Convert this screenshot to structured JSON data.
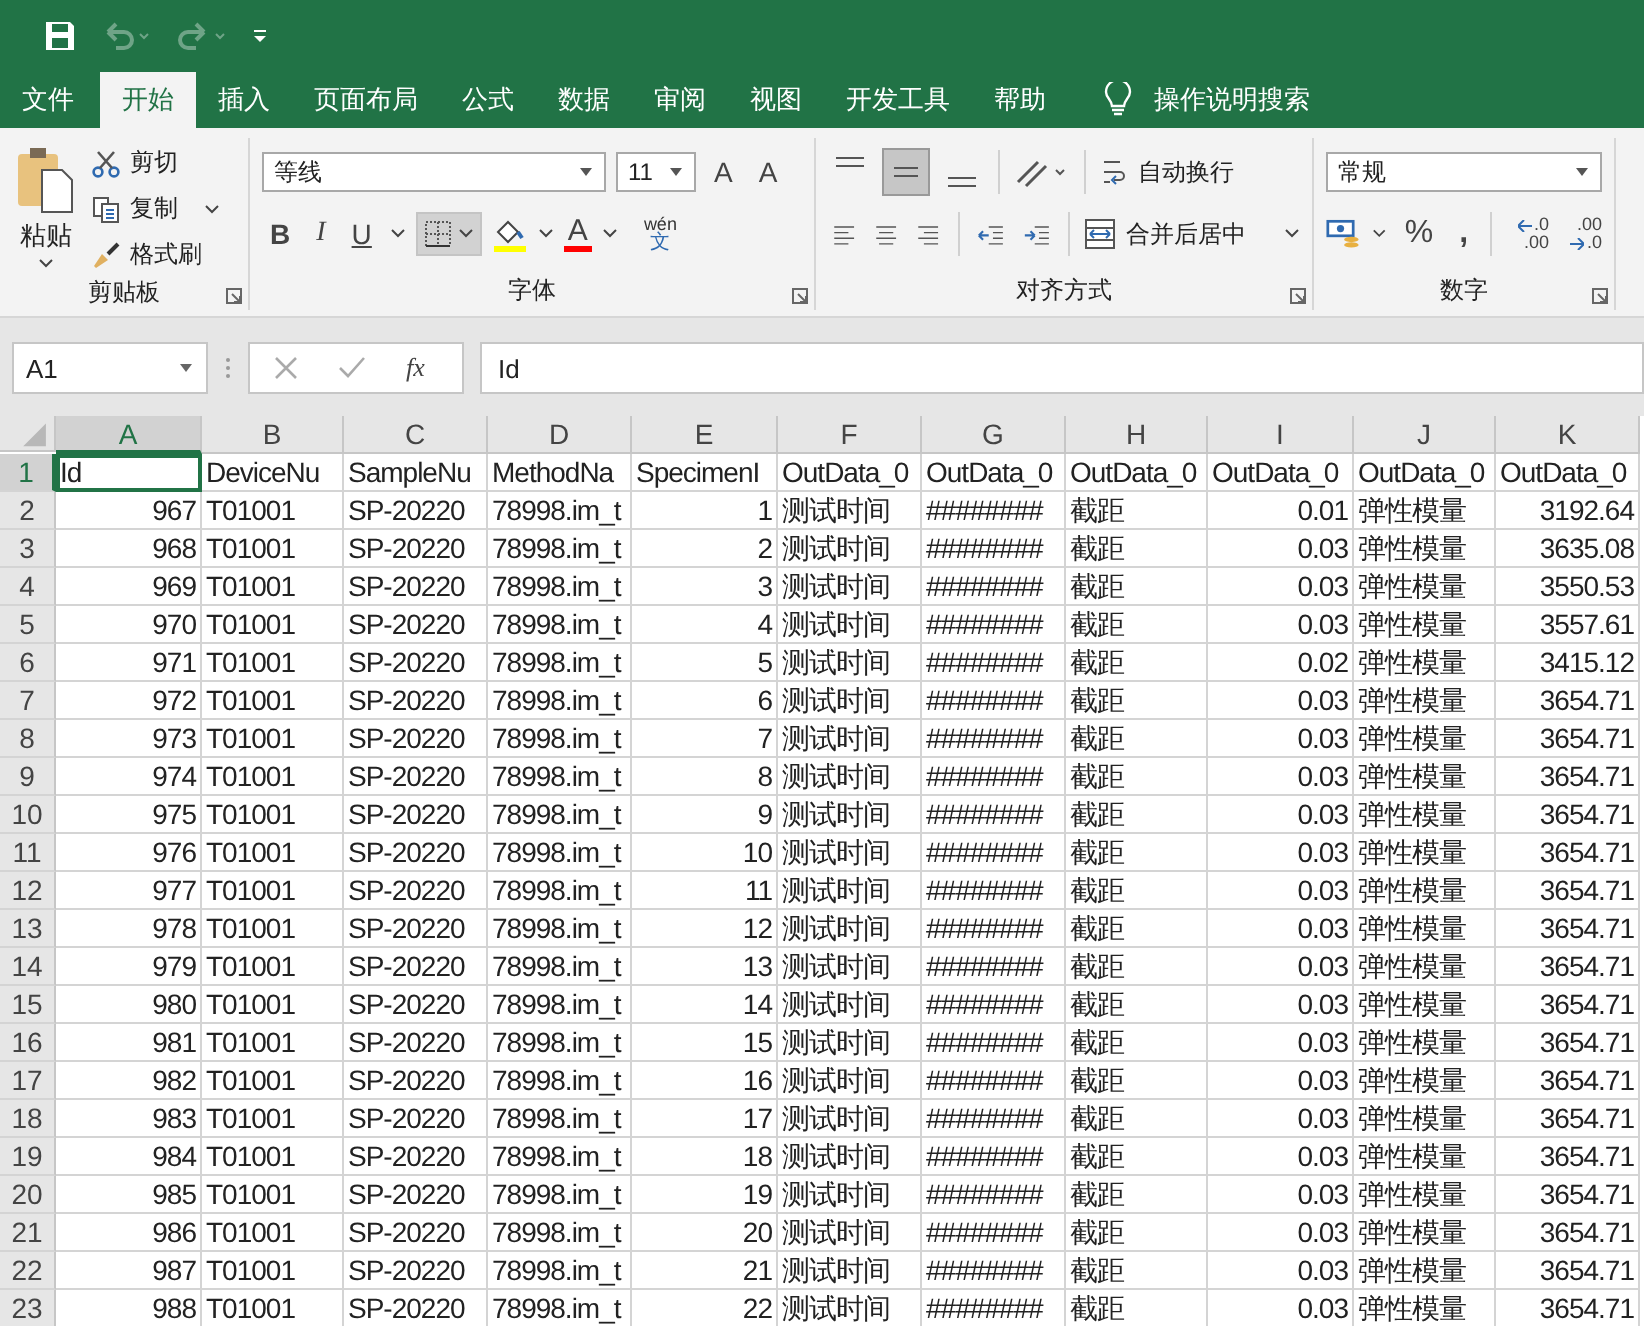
{
  "menu_tabs": [
    {
      "label": "文件",
      "selected": false
    },
    {
      "label": "开始",
      "selected": true
    },
    {
      "label": "插入",
      "selected": false
    },
    {
      "label": "页面布局",
      "selected": false
    },
    {
      "label": "公式",
      "selected": false
    },
    {
      "label": "数据",
      "selected": false
    },
    {
      "label": "审阅",
      "selected": false
    },
    {
      "label": "视图",
      "selected": false
    },
    {
      "label": "开发工具",
      "selected": false
    },
    {
      "label": "帮助",
      "selected": false
    }
  ],
  "tell_me": "操作说明搜索",
  "clipboard": {
    "paste": "粘贴",
    "cut": "剪切",
    "copy": "复制",
    "format_painter": "格式刷",
    "label": "剪贴板"
  },
  "font": {
    "name": "等线",
    "size": "11",
    "grow": "A",
    "shrink": "A",
    "bold": "B",
    "italic": "I",
    "underline": "U",
    "font_color": "A",
    "phonetic_top": "wén",
    "phonetic_bottom": "文",
    "label": "字体"
  },
  "alignment": {
    "wrap_text": "自动换行",
    "merge_center": "合并后居中",
    "label": "对齐方式",
    "middle_align_selected": true
  },
  "number": {
    "format": "常规",
    "percent": "%",
    "comma": ",",
    "increase_decimal": [
      ".0",
      ".00"
    ],
    "decrease_decimal": [
      ".00",
      ".0"
    ],
    "label": "数字"
  },
  "formula_bar": {
    "name_box": "A1",
    "fx": "fx",
    "value": "Id"
  },
  "columns": [
    {
      "letter": "A",
      "selected": true,
      "numeric": true
    },
    {
      "letter": "B",
      "selected": false,
      "numeric": false
    },
    {
      "letter": "C",
      "selected": false,
      "numeric": false
    },
    {
      "letter": "D",
      "selected": false,
      "numeric": false
    },
    {
      "letter": "E",
      "selected": false,
      "numeric": true
    },
    {
      "letter": "F",
      "selected": false,
      "numeric": false
    },
    {
      "letter": "G",
      "selected": false,
      "numeric": false
    },
    {
      "letter": "H",
      "selected": false,
      "numeric": false
    },
    {
      "letter": "I",
      "selected": false,
      "numeric": true
    },
    {
      "letter": "J",
      "selected": false,
      "numeric": false
    },
    {
      "letter": "K",
      "selected": false,
      "numeric": true
    }
  ],
  "header_row": {
    "number": "1",
    "selected": true,
    "cells": [
      "Id",
      "DeviceNu",
      "SampleNu",
      "MethodNa",
      "SpecimenI",
      "OutData_0",
      "OutData_0",
      "OutData_0",
      "OutData_0",
      "OutData_0",
      "OutData_0"
    ]
  },
  "rows": [
    {
      "number": "2",
      "cells": [
        "967",
        "T01001",
        "SP-20220",
        "78998.im_t",
        "1",
        "测试时间",
        "########",
        "截距",
        "0.01",
        "弹性模量",
        "3192.64"
      ]
    },
    {
      "number": "3",
      "cells": [
        "968",
        "T01001",
        "SP-20220",
        "78998.im_t",
        "2",
        "测试时间",
        "########",
        "截距",
        "0.03",
        "弹性模量",
        "3635.08"
      ]
    },
    {
      "number": "4",
      "cells": [
        "969",
        "T01001",
        "SP-20220",
        "78998.im_t",
        "3",
        "测试时间",
        "########",
        "截距",
        "0.03",
        "弹性模量",
        "3550.53"
      ]
    },
    {
      "number": "5",
      "cells": [
        "970",
        "T01001",
        "SP-20220",
        "78998.im_t",
        "4",
        "测试时间",
        "########",
        "截距",
        "0.03",
        "弹性模量",
        "3557.61"
      ]
    },
    {
      "number": "6",
      "cells": [
        "971",
        "T01001",
        "SP-20220",
        "78998.im_t",
        "5",
        "测试时间",
        "########",
        "截距",
        "0.02",
        "弹性模量",
        "3415.12"
      ]
    },
    {
      "number": "7",
      "cells": [
        "972",
        "T01001",
        "SP-20220",
        "78998.im_t",
        "6",
        "测试时间",
        "########",
        "截距",
        "0.03",
        "弹性模量",
        "3654.71"
      ]
    },
    {
      "number": "8",
      "cells": [
        "973",
        "T01001",
        "SP-20220",
        "78998.im_t",
        "7",
        "测试时间",
        "########",
        "截距",
        "0.03",
        "弹性模量",
        "3654.71"
      ]
    },
    {
      "number": "9",
      "cells": [
        "974",
        "T01001",
        "SP-20220",
        "78998.im_t",
        "8",
        "测试时间",
        "########",
        "截距",
        "0.03",
        "弹性模量",
        "3654.71"
      ]
    },
    {
      "number": "10",
      "cells": [
        "975",
        "T01001",
        "SP-20220",
        "78998.im_t",
        "9",
        "测试时间",
        "########",
        "截距",
        "0.03",
        "弹性模量",
        "3654.71"
      ]
    },
    {
      "number": "11",
      "cells": [
        "976",
        "T01001",
        "SP-20220",
        "78998.im_t",
        "10",
        "测试时间",
        "########",
        "截距",
        "0.03",
        "弹性模量",
        "3654.71"
      ]
    },
    {
      "number": "12",
      "cells": [
        "977",
        "T01001",
        "SP-20220",
        "78998.im_t",
        "11",
        "测试时间",
        "########",
        "截距",
        "0.03",
        "弹性模量",
        "3654.71"
      ]
    },
    {
      "number": "13",
      "cells": [
        "978",
        "T01001",
        "SP-20220",
        "78998.im_t",
        "12",
        "测试时间",
        "########",
        "截距",
        "0.03",
        "弹性模量",
        "3654.71"
      ]
    },
    {
      "number": "14",
      "cells": [
        "979",
        "T01001",
        "SP-20220",
        "78998.im_t",
        "13",
        "测试时间",
        "########",
        "截距",
        "0.03",
        "弹性模量",
        "3654.71"
      ]
    },
    {
      "number": "15",
      "cells": [
        "980",
        "T01001",
        "SP-20220",
        "78998.im_t",
        "14",
        "测试时间",
        "########",
        "截距",
        "0.03",
        "弹性模量",
        "3654.71"
      ]
    },
    {
      "number": "16",
      "cells": [
        "981",
        "T01001",
        "SP-20220",
        "78998.im_t",
        "15",
        "测试时间",
        "########",
        "截距",
        "0.03",
        "弹性模量",
        "3654.71"
      ]
    },
    {
      "number": "17",
      "cells": [
        "982",
        "T01001",
        "SP-20220",
        "78998.im_t",
        "16",
        "测试时间",
        "########",
        "截距",
        "0.03",
        "弹性模量",
        "3654.71"
      ]
    },
    {
      "number": "18",
      "cells": [
        "983",
        "T01001",
        "SP-20220",
        "78998.im_t",
        "17",
        "测试时间",
        "########",
        "截距",
        "0.03",
        "弹性模量",
        "3654.71"
      ]
    },
    {
      "number": "19",
      "cells": [
        "984",
        "T01001",
        "SP-20220",
        "78998.im_t",
        "18",
        "测试时间",
        "########",
        "截距",
        "0.03",
        "弹性模量",
        "3654.71"
      ]
    },
    {
      "number": "20",
      "cells": [
        "985",
        "T01001",
        "SP-20220",
        "78998.im_t",
        "19",
        "测试时间",
        "########",
        "截距",
        "0.03",
        "弹性模量",
        "3654.71"
      ]
    },
    {
      "number": "21",
      "cells": [
        "986",
        "T01001",
        "SP-20220",
        "78998.im_t",
        "20",
        "测试时间",
        "########",
        "截距",
        "0.03",
        "弹性模量",
        "3654.71"
      ]
    },
    {
      "number": "22",
      "cells": [
        "987",
        "T01001",
        "SP-20220",
        "78998.im_t",
        "21",
        "测试时间",
        "########",
        "截距",
        "0.03",
        "弹性模量",
        "3654.71"
      ]
    },
    {
      "number": "23",
      "cells": [
        "988",
        "T01001",
        "SP-20220",
        "78998.im_t",
        "22",
        "测试时间",
        "########",
        "截距",
        "0.03",
        "弹性模量",
        "3654.71"
      ]
    }
  ]
}
